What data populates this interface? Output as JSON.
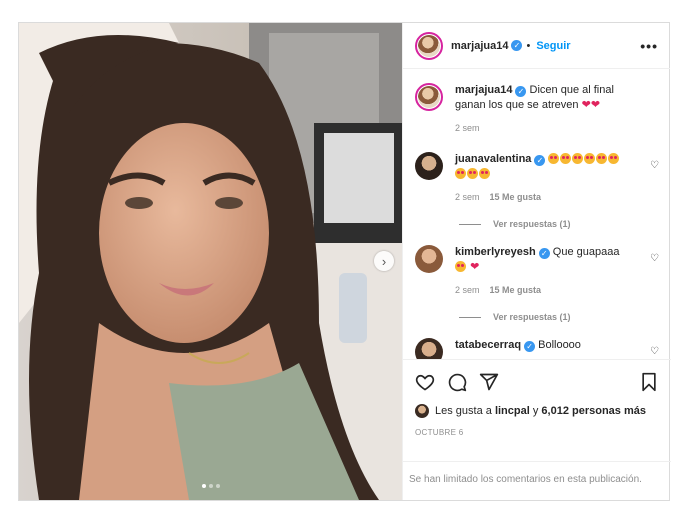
{
  "post": {
    "slide_count": 3,
    "active_slide": 1
  },
  "header": {
    "username": "marjajua14",
    "follow_label": "Seguir",
    "more_label": "•••"
  },
  "caption": {
    "username": "marjajua14",
    "text": "Dicen que al final ganan los que se atreven",
    "time": "2 sem"
  },
  "comments": [
    {
      "username": "juanavalentina",
      "text": "",
      "emoji_count": 9,
      "time": "2 sem",
      "likes": "15 Me gusta",
      "replies": "Ver respuestas (1)"
    },
    {
      "username": "kimberlyreyesh",
      "text": "Que guapaaa",
      "time": "2 sem",
      "likes": "15 Me gusta",
      "replies": "Ver respuestas (1)"
    },
    {
      "username": "tatabecerraq",
      "text": "Bolloooo"
    }
  ],
  "likes": {
    "prefix": "Les gusta a",
    "user": "lincpal",
    "middle": "y",
    "count": "6,012 personas más"
  },
  "date": "OCTUBRE 6",
  "comments_limited": "Se han limitado los comentarios en esta publicación.",
  "icons": {
    "like": "heart-icon",
    "comment": "comment-icon",
    "share": "send-icon",
    "save": "bookmark-icon",
    "next": "chevron-right-icon",
    "verified": "verified-badge-icon"
  },
  "colors": {
    "accent": "#0095f6",
    "verified": "#3897f0",
    "heart": "#e0245e"
  }
}
